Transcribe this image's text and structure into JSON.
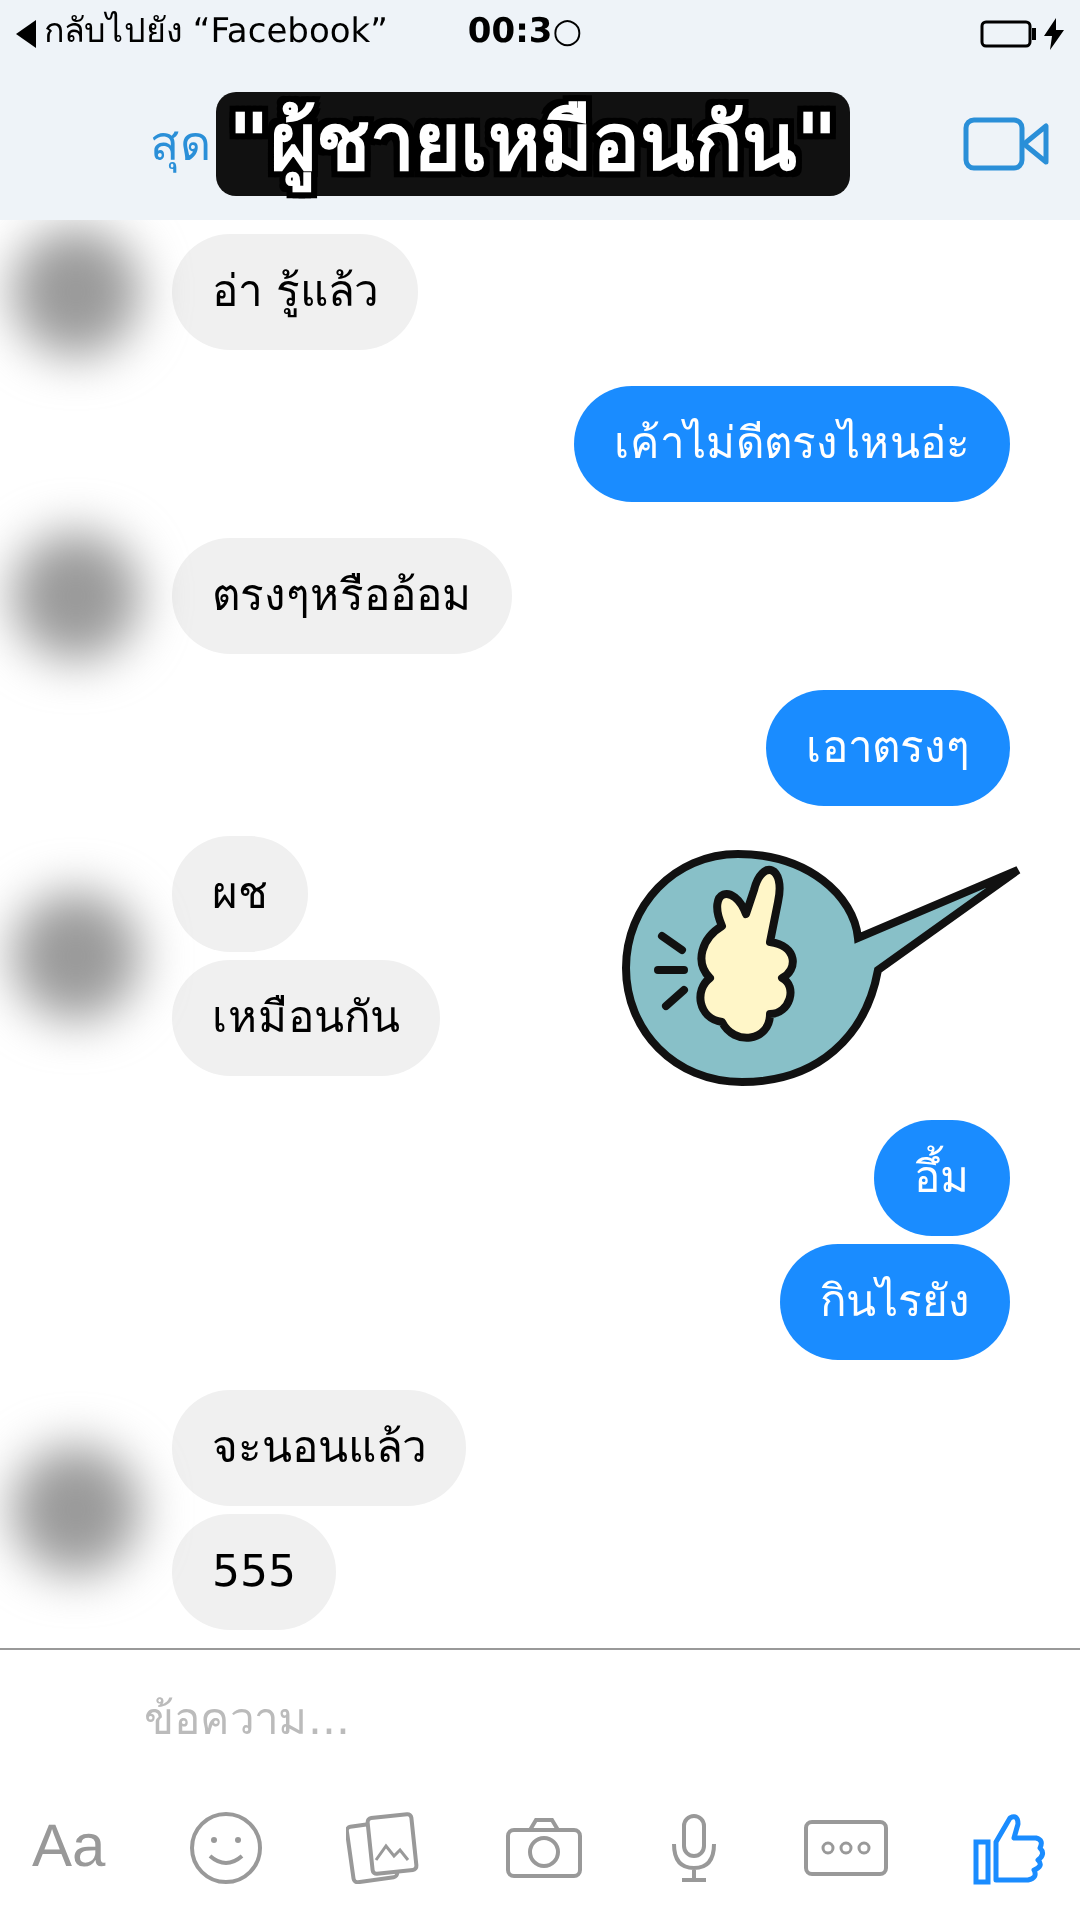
{
  "status_bar": {
    "back_label": "กลับไปยัง “Facebook”",
    "time": "00:3○"
  },
  "header": {
    "title_fragment": "สุด",
    "caption": "\"ผู้ชายเหมือนกัน\""
  },
  "groups": [
    {
      "kind": "incoming",
      "messages": [
        "อ่า รู้แล้ว"
      ]
    },
    {
      "kind": "outgoing",
      "messages": [
        "เค้าไม่ดีตรงไหนอ่ะ"
      ]
    },
    {
      "kind": "incoming",
      "messages": [
        "ตรงๆหรืออ้อม"
      ]
    },
    {
      "kind": "outgoing",
      "messages": [
        "เอาตรงๆ"
      ]
    },
    {
      "kind": "incoming",
      "messages": [
        "ผช",
        "เหมือนกัน"
      ]
    },
    {
      "kind": "sticker"
    },
    {
      "kind": "outgoing",
      "messages": [
        "อึ้ม",
        "กินไรยัง"
      ]
    },
    {
      "kind": "incoming",
      "messages": [
        "จะนอนแล้ว",
        "555"
      ]
    }
  ],
  "composer": {
    "placeholder": "ข้อความ...",
    "font_button": "Aa"
  }
}
